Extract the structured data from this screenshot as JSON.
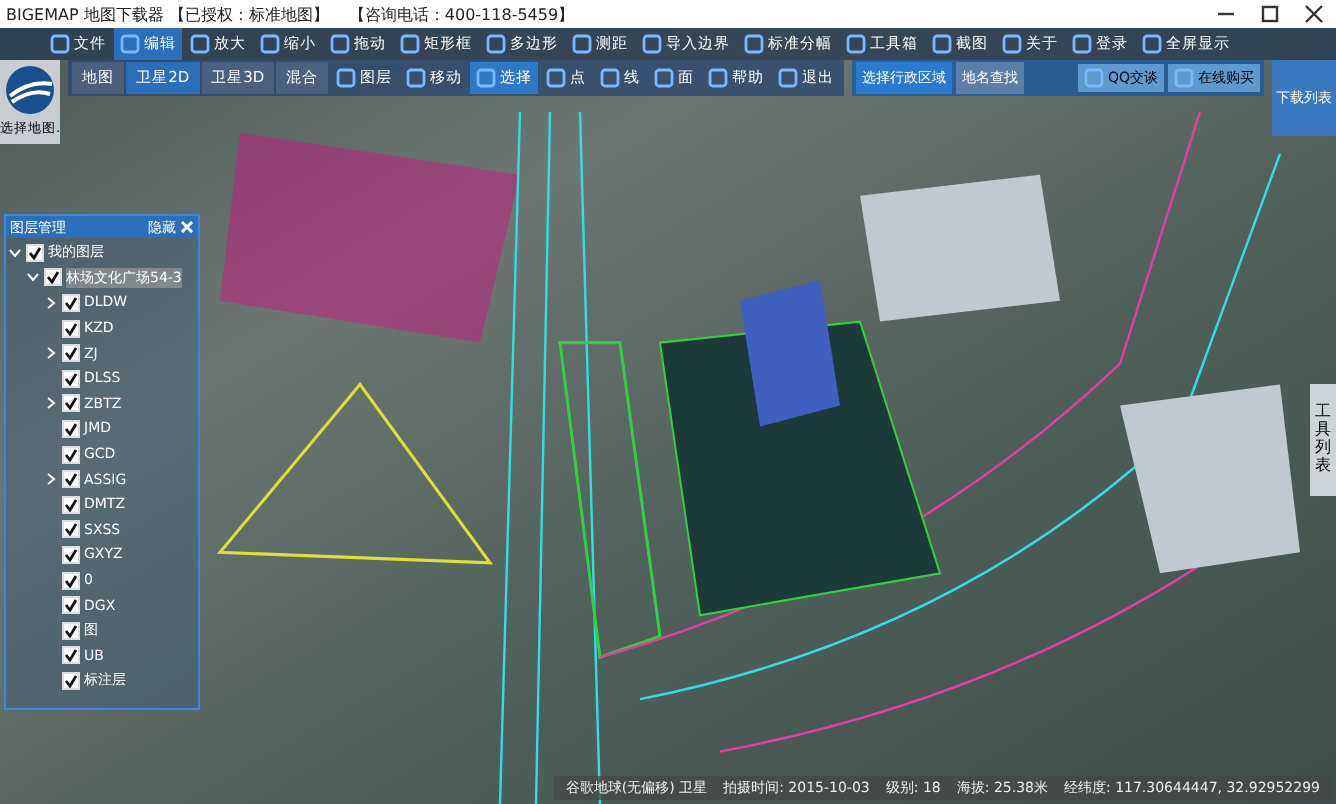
{
  "window": {
    "title": "BIGEMAP 地图下载器 【已授权：标准地图】",
    "hotline": "【咨询电话：400-118-5459】"
  },
  "main_toolbar": [
    {
      "label": "文件",
      "selected": false
    },
    {
      "label": "编辑",
      "selected": true
    },
    {
      "label": "放大",
      "selected": false
    },
    {
      "label": "缩小",
      "selected": false
    },
    {
      "label": "拖动",
      "selected": false
    },
    {
      "label": "矩形框",
      "selected": false
    },
    {
      "label": "多边形",
      "selected": false
    },
    {
      "label": "测距",
      "selected": false
    },
    {
      "label": "导入边界",
      "selected": false
    },
    {
      "label": "标准分幅",
      "selected": false
    },
    {
      "label": "工具箱",
      "selected": false
    },
    {
      "label": "截图",
      "selected": false
    },
    {
      "label": "关于",
      "selected": false
    },
    {
      "label": "登录",
      "selected": false
    },
    {
      "label": "全屏显示",
      "selected": false
    }
  ],
  "map_picker": {
    "label": "选择地图."
  },
  "map_types": [
    {
      "label": "地图",
      "selected": false
    },
    {
      "label": "卫星2D",
      "selected": true
    },
    {
      "label": "卫星3D",
      "selected": false
    },
    {
      "label": "混合",
      "selected": false
    }
  ],
  "tools": [
    {
      "label": "图层",
      "selected": false
    },
    {
      "label": "移动",
      "selected": false
    },
    {
      "label": "选择",
      "selected": true
    },
    {
      "label": "点",
      "selected": false
    },
    {
      "label": "线",
      "selected": false
    },
    {
      "label": "面",
      "selected": false
    },
    {
      "label": "帮助",
      "selected": false
    },
    {
      "label": "退出",
      "selected": false
    }
  ],
  "region_tabs": [
    {
      "label": "选择行政区域",
      "selected": true
    },
    {
      "label": "地名查找",
      "selected": false
    }
  ],
  "contact_buttons": [
    "QQ交谈",
    "在线购买"
  ],
  "download_list": {
    "label": "下载列表"
  },
  "layer_panel": {
    "title": "图层管理",
    "action": "隐藏",
    "tree": [
      {
        "label": "我的图层",
        "checked": true,
        "expanded": true,
        "children": [
          {
            "label": "林场文化广场54-3",
            "checked": true,
            "expanded": true,
            "children": [
              {
                "label": "DLDW",
                "checked": true,
                "expanded": false
              },
              {
                "label": "KZD",
                "checked": true
              },
              {
                "label": "ZJ",
                "checked": true,
                "expanded": false
              },
              {
                "label": "DLSS",
                "checked": true
              },
              {
                "label": "ZBTZ",
                "checked": true,
                "expanded": false
              },
              {
                "label": "JMD",
                "checked": true
              },
              {
                "label": "GCD",
                "checked": true
              },
              {
                "label": "ASSIG",
                "checked": true,
                "expanded": false
              },
              {
                "label": "DMTZ",
                "checked": true
              },
              {
                "label": "SXSS",
                "checked": true
              },
              {
                "label": "GXYZ",
                "checked": true
              },
              {
                "label": "0",
                "checked": true
              },
              {
                "label": "DGX",
                "checked": true
              },
              {
                "label": "图",
                "checked": true
              },
              {
                "label": "UB",
                "checked": true
              },
              {
                "label": "标注层",
                "checked": true
              }
            ]
          }
        ]
      }
    ]
  },
  "side_tab": {
    "label": "工具列表"
  },
  "status_bar": [
    "谷歌地球(无偏移) 卫星",
    "拍摄时间: 2015-10-03",
    "级别: 18",
    "海拔: 25.38米",
    "经纬度: 117.30644447, 32.92952299"
  ]
}
